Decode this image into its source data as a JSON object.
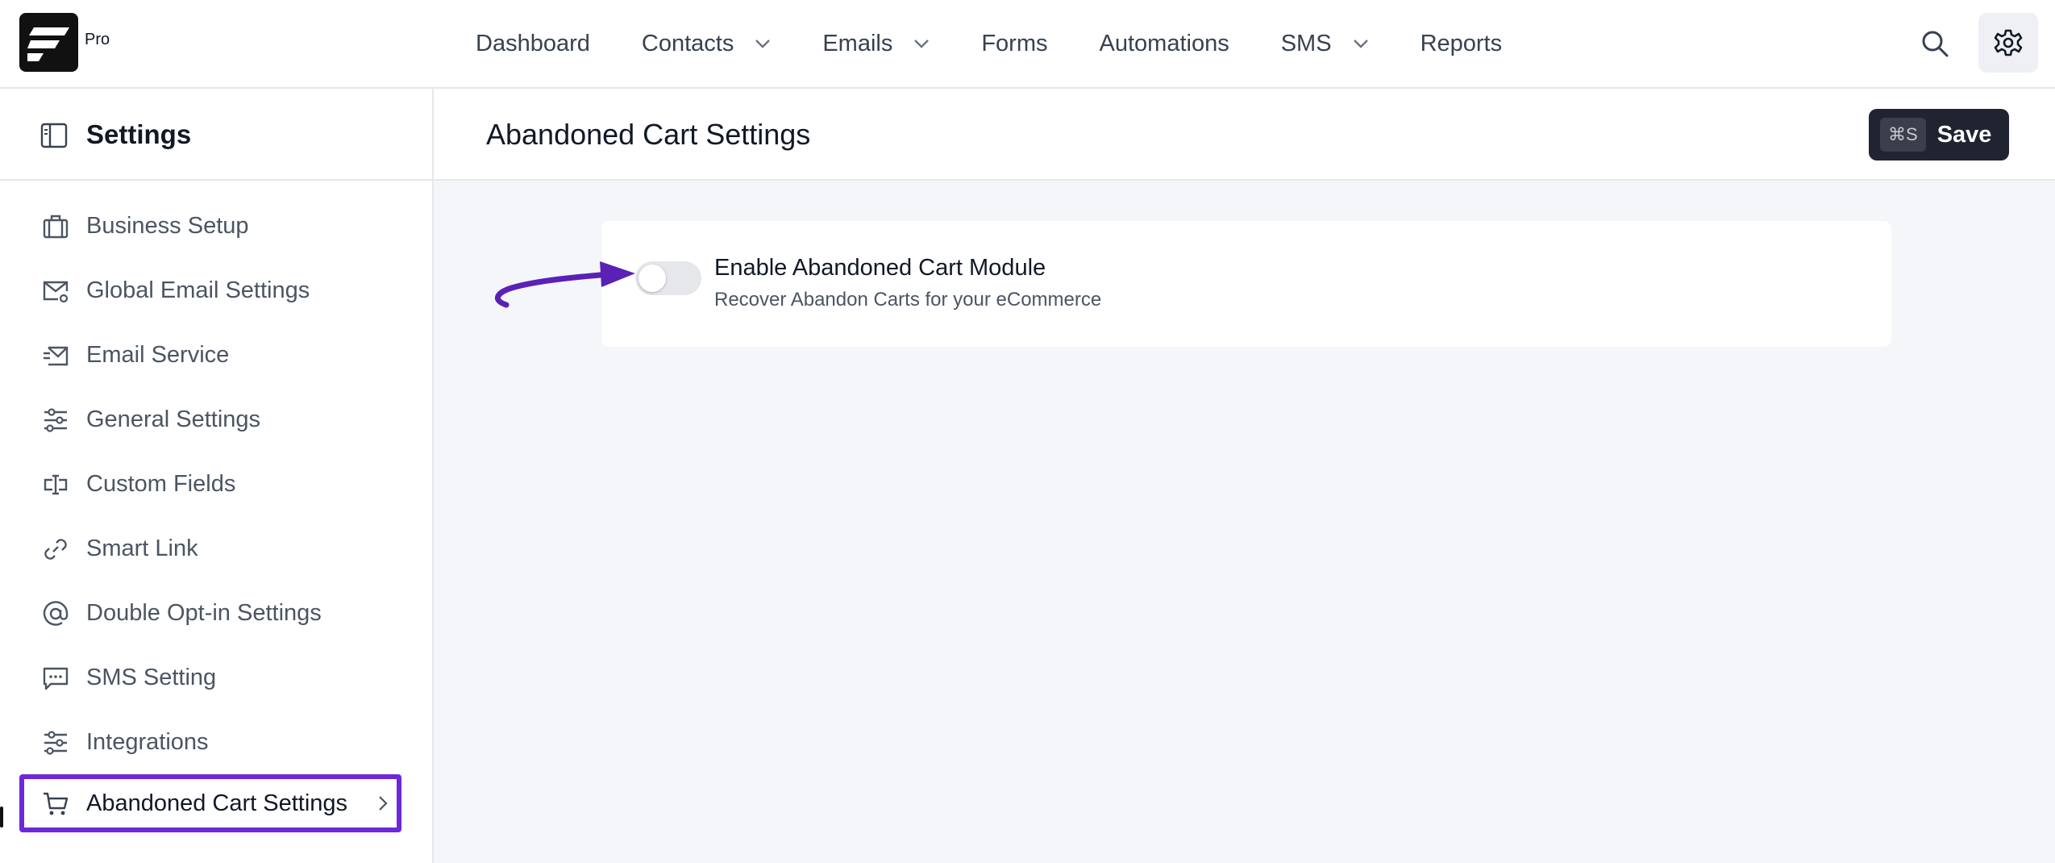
{
  "app": {
    "brand_badge": "Pro"
  },
  "nav": {
    "items": [
      {
        "label": "Dashboard",
        "has_dropdown": false
      },
      {
        "label": "Contacts",
        "has_dropdown": true
      },
      {
        "label": "Emails",
        "has_dropdown": true
      },
      {
        "label": "Forms",
        "has_dropdown": false
      },
      {
        "label": "Automations",
        "has_dropdown": false
      },
      {
        "label": "SMS",
        "has_dropdown": true
      },
      {
        "label": "Reports",
        "has_dropdown": false
      }
    ],
    "icons": [
      "search-icon",
      "gear-icon"
    ]
  },
  "sidebar": {
    "title": "Settings",
    "items": [
      {
        "label": "Business Setup",
        "icon": "briefcase-icon"
      },
      {
        "label": "Global Email Settings",
        "icon": "mail-gear-icon"
      },
      {
        "label": "Email Service",
        "icon": "send-mail-icon"
      },
      {
        "label": "General Settings",
        "icon": "sliders-icon"
      },
      {
        "label": "Custom Fields",
        "icon": "text-field-icon"
      },
      {
        "label": "Smart Link",
        "icon": "link-icon"
      },
      {
        "label": "Double Opt-in Settings",
        "icon": "at-icon"
      },
      {
        "label": "SMS Setting",
        "icon": "message-icon"
      },
      {
        "label": "Integrations",
        "icon": "sliders-icon"
      },
      {
        "label": "Abandoned Cart Settings",
        "icon": "cart-icon",
        "active": true
      }
    ]
  },
  "main": {
    "title": "Abandoned Cart Settings",
    "save": {
      "shortcut": "⌘S",
      "label": "Save"
    },
    "module": {
      "title": "Enable Abandoned Cart Module",
      "description": "Recover Abandon Carts for your eCommerce",
      "enabled": false
    }
  },
  "colors": {
    "accent": "#6d28d9",
    "save_bg": "#1f2430",
    "main_bg": "#f5f6fa"
  }
}
